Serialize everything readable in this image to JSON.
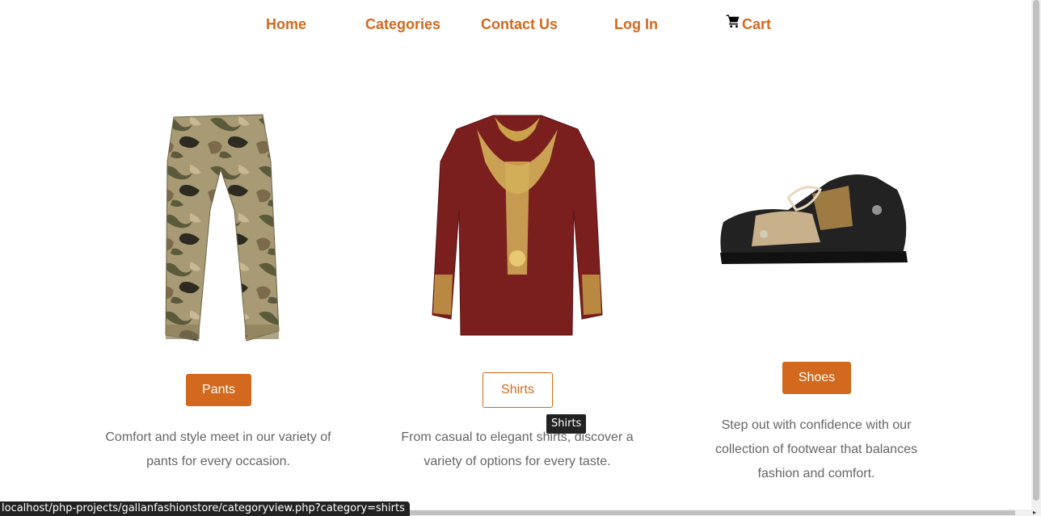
{
  "nav": {
    "home": "Home",
    "categories": "Categories",
    "contact": "Contact Us",
    "login": "Log In",
    "cart": "Cart",
    "cart_icon": "shopping-cart-icon"
  },
  "categories": [
    {
      "button": "Pants",
      "description": "Comfort and style meet in our variety of pants for every occasion.",
      "image": "camouflage-cargo-pants-image"
    },
    {
      "button": "Shirts",
      "description": "From casual to elegant shirts, discover a variety of options for every taste.",
      "image": "maroon-gold-embroidered-shirt-image"
    },
    {
      "button": "Shoes",
      "description": "Step out with confidence with our collection of footwear that balances fashion and comfort.",
      "image": "black-paisley-sneaker-image"
    }
  ],
  "tooltip": "Shirts",
  "status_url": "localhost/php-projects/gallanfashionstore/categoryview.php?category=shirts",
  "colors": {
    "accent": "#d2691e",
    "text_muted": "#666666",
    "tooltip_bg": "#222222"
  }
}
